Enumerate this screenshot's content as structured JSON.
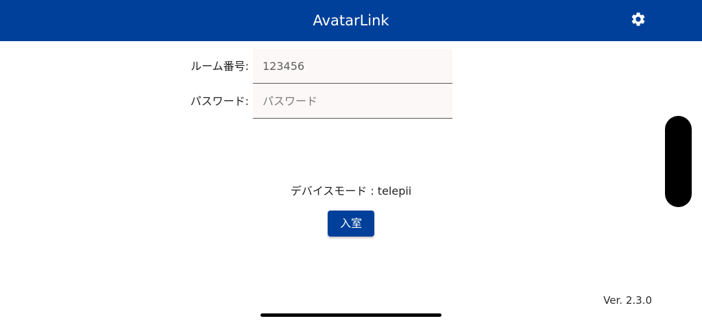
{
  "header": {
    "title": "AvatarLink",
    "settings_icon": "gear-icon",
    "background_color": "#00409A"
  },
  "form": {
    "room": {
      "label": "ルーム番号:",
      "value": "123456",
      "placeholder": ""
    },
    "password": {
      "label": "パスワード:",
      "value": "",
      "placeholder": "パスワード"
    }
  },
  "device_mode": "デバイスモード : telepii",
  "enter_button": {
    "label": "入室",
    "color": "#00409A"
  },
  "footer": {
    "version": "Ver. 2.3.0"
  }
}
